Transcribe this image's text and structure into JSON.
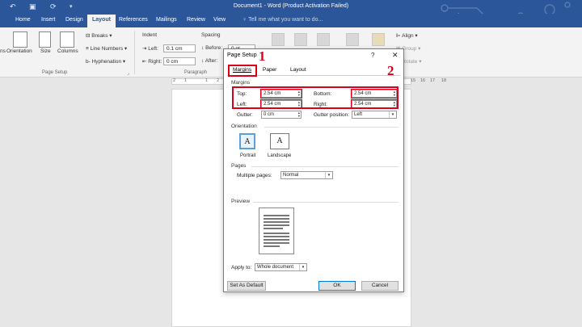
{
  "app": {
    "window_title": "Document1 - Word (Product Activation Failed)",
    "tell_me": "Tell me what you want to do...",
    "accent": "#2b579a"
  },
  "tabs": [
    "Home",
    "Insert",
    "Design",
    "Layout",
    "References",
    "Mailings",
    "Review",
    "View"
  ],
  "ribbon": {
    "page_setup": {
      "orientation": "Orientation",
      "size": "Size",
      "columns": "Columns",
      "breaks": "Breaks",
      "line_numbers": "Line Numbers",
      "hyphenation": "Hyphenation",
      "group_name": "Page Setup",
      "left_fragment": "ns"
    },
    "paragraph": {
      "indent": "Indent",
      "spacing": "Spacing",
      "left_label": "Left:",
      "left_value": "0.1 cm",
      "right_label": "Right:",
      "right_value": "0 cm",
      "before_label": "Before:",
      "before_value": "0 pt",
      "after_label": "After:",
      "group_name": "Paragraph"
    },
    "arrange": {
      "align": "Align",
      "group": "Group",
      "rotate": "Rotate"
    }
  },
  "ruler": {
    "left_marks": [
      "2",
      "1",
      "1",
      "2"
    ],
    "right_marks": [
      "15",
      "16",
      "17",
      "18"
    ]
  },
  "dialog": {
    "title": "Page Setup",
    "help": "?",
    "close": "✕",
    "tabs": [
      "Margins",
      "Paper",
      "Layout"
    ],
    "margins_section": "Margins",
    "top_label": "Top:",
    "top_value": "2.54 cm",
    "bottom_label": "Bottom:",
    "bottom_value": "2.54 cm",
    "left_label": "Left:",
    "left_value": "2.54 cm",
    "right_label": "Right:",
    "right_value": "2.54 cm",
    "gutter_label": "Gutter:",
    "gutter_value": "0 cm",
    "gutter_position_label": "Gutter position:",
    "gutter_position_value": "Left",
    "orientation_section": "Orientation",
    "portrait": "Portrait",
    "landscape": "Landscape",
    "pages_section": "Pages",
    "multiple_pages_label": "Multiple pages:",
    "multiple_pages_value": "Normal",
    "preview_section": "Preview",
    "apply_to_label": "Apply to:",
    "apply_to_value": "Whole document",
    "set_as_default": "Set As Default",
    "ok": "OK",
    "cancel": "Cancel"
  },
  "annotations": {
    "one": "1",
    "two": "2",
    "color": "#d9001b"
  }
}
